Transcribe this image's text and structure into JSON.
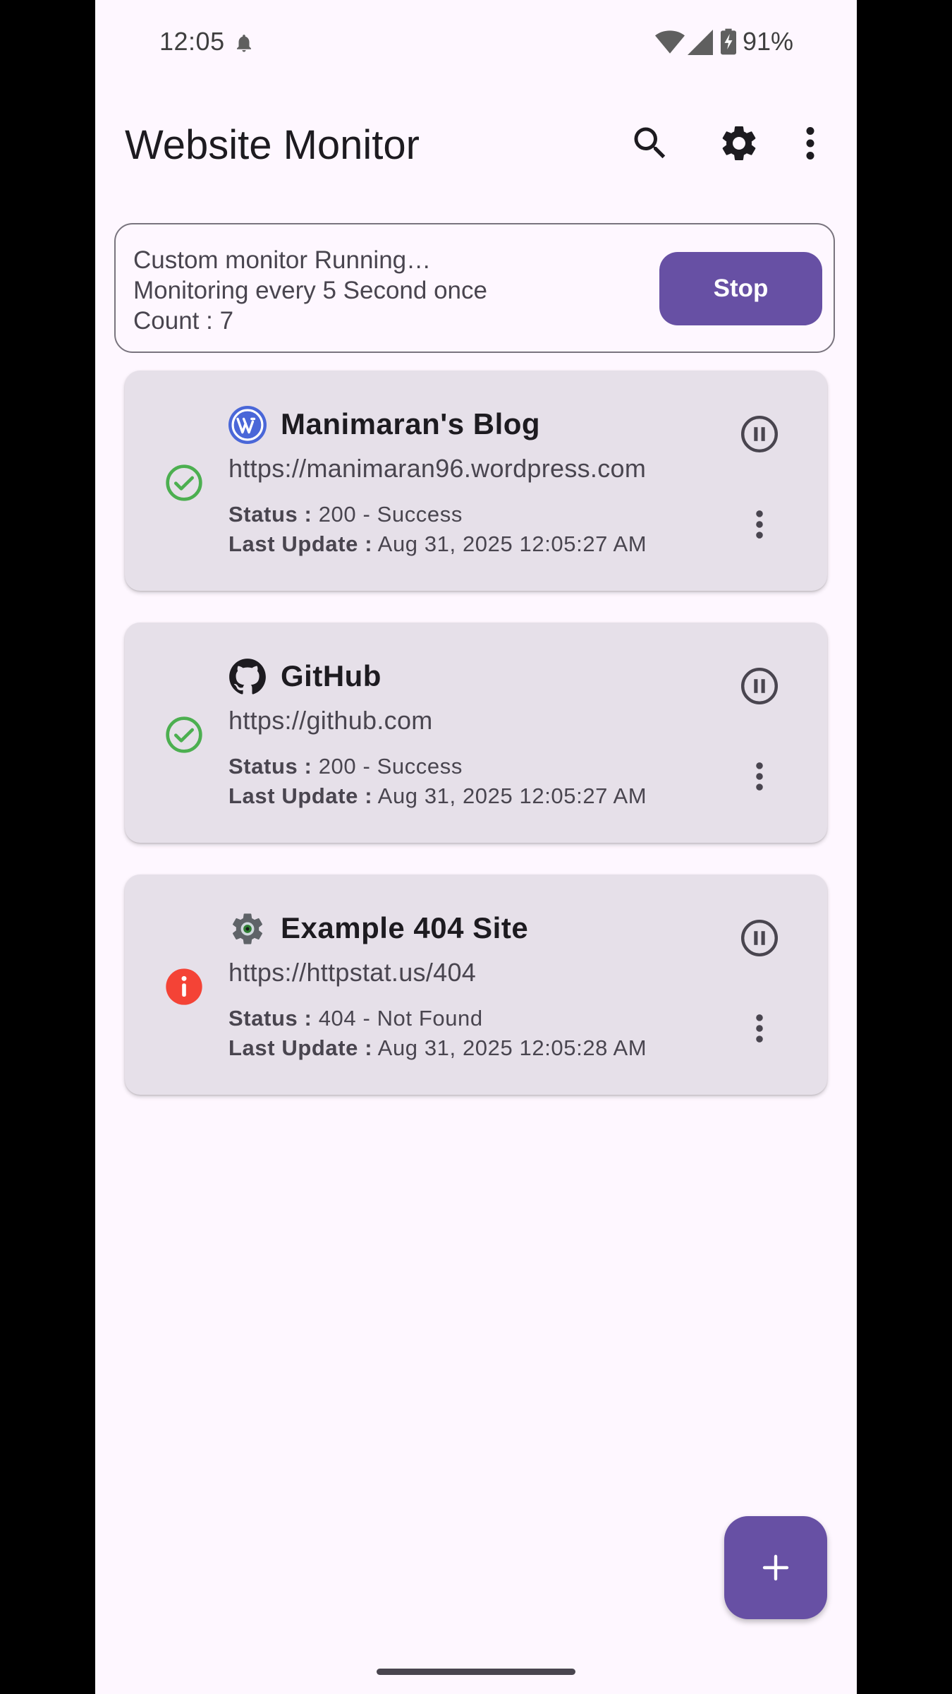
{
  "status_bar": {
    "time": "12:05",
    "battery_pct": "91%",
    "icons": [
      "notification-bell-icon",
      "wifi-icon",
      "cell-signal-icon",
      "battery-charging-icon"
    ]
  },
  "app_bar": {
    "title": "Website Monitor",
    "actions": [
      "search-icon",
      "settings-gear-icon",
      "more-vert-icon"
    ]
  },
  "monitor": {
    "line1": "Custom monitor Running…",
    "line2": "Monitoring every 5 Second once",
    "line3": "Count : 7",
    "stop_label": "Stop"
  },
  "labels": {
    "status": "Status :",
    "last_update": "Last Update :"
  },
  "sites": [
    {
      "name": "Manimaran's Blog",
      "url": "https://manimaran96.wordpress.com",
      "status": "200 - Success",
      "last_update": "Aug 31, 2025 12:05:27 AM",
      "state": "success",
      "icon": "wordpress-icon"
    },
    {
      "name": "GitHub",
      "url": "https://github.com",
      "status": "200 - Success",
      "last_update": "Aug 31, 2025 12:05:27 AM",
      "state": "success",
      "icon": "github-icon"
    },
    {
      "name": "Example 404 Site",
      "url": "https://httpstat.us/404",
      "status": "404 - Not Found",
      "last_update": "Aug 31, 2025 12:05:28 AM",
      "state": "error",
      "icon": "default-site-gear-icon"
    }
  ],
  "colors": {
    "primary": "#6750A4",
    "card_bg": "#E6E0E9",
    "success": "#4CAF50",
    "error": "#F44336",
    "background": "#FEF7FF"
  },
  "fab": {
    "icon": "add-icon"
  }
}
